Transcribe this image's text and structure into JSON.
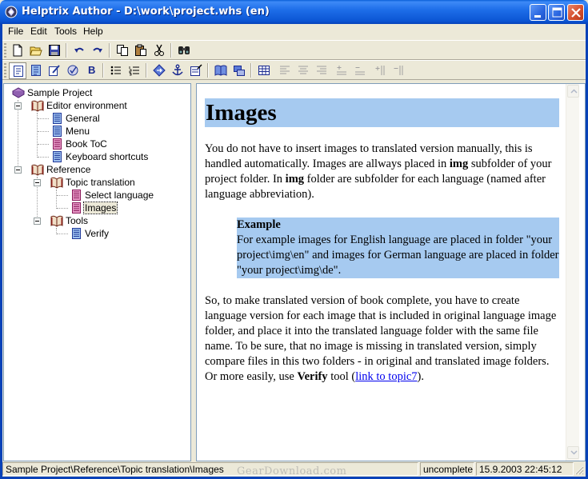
{
  "window": {
    "title": "Helptrix Author - D:\\work\\project.whs (en)",
    "app_icon": "helptrix-app-icon",
    "buttons": [
      "minimize-icon",
      "maximize-icon",
      "close-icon"
    ]
  },
  "menu": {
    "items": [
      "File",
      "Edit",
      "Tools",
      "Help"
    ]
  },
  "toolbar1": {
    "buttons": [
      "new-icon",
      "open-icon",
      "save-icon",
      "undo-icon",
      "redo-icon",
      "copy-icon",
      "paste-icon",
      "cut-icon",
      "find-icon"
    ]
  },
  "toolbar2": {
    "buttons": [
      "topic-view-icon",
      "source-view-icon",
      "edit-icon",
      "spellcheck-icon",
      "bold-icon",
      "bullet-list-icon",
      "numbered-list-icon",
      "link-icon",
      "anchor-icon",
      "properties-icon",
      "book-icon",
      "publish-icon",
      "table-icon",
      "align-left-icon",
      "align-center-icon",
      "align-right-icon",
      "insert-row-icon",
      "delete-row-icon",
      "insert-column-icon",
      "delete-column-icon"
    ],
    "bold_label": "B"
  },
  "tree": {
    "root": "Sample Project",
    "items": [
      {
        "label": "Editor environment",
        "type": "book"
      },
      {
        "label": "General",
        "type": "page"
      },
      {
        "label": "Menu",
        "type": "page"
      },
      {
        "label": "Book ToC",
        "type": "page-pink"
      },
      {
        "label": "Keyboard shortcuts",
        "type": "page"
      },
      {
        "label": "Reference",
        "type": "book"
      },
      {
        "label": "Topic translation",
        "type": "book"
      },
      {
        "label": "Select language",
        "type": "page-pink"
      },
      {
        "label": "Images",
        "type": "page-pink"
      },
      {
        "label": "Tools",
        "type": "book"
      },
      {
        "label": "Verify",
        "type": "page"
      }
    ],
    "selected": "Images"
  },
  "document": {
    "title": "Images",
    "p1_a": "You do not have to insert images to translated version manually, this is handled automatically. Images are allways placed in ",
    "p1_b": "img",
    "p1_c": " subfolder of your project folder. In ",
    "p1_d": "img",
    "p1_e": " folder are subfolder for each language (named after language abbreviation).",
    "example_title": "Example",
    "example_text": "For example images for English language are placed in folder \"your project\\img\\en\" and images for German language are placed in folder \"your project\\img\\de\".",
    "p2_a": "So, to make translated version of book complete, you have to create language version for each image that is included in original language image folder, and place it into the translated language folder with the same file name. To be sure, that no image is missing in translated version, simply compare files in this two folders - in original and translated image folders. Or more easily, use ",
    "p2_b": "Verify",
    "p2_c": " tool (",
    "p2_link": "link to topic7",
    "p2_d": ")."
  },
  "status": {
    "path": "Sample Project\\Reference\\Topic translation\\Images",
    "state": "uncomplete",
    "datetime": "15.9.2003 22:45:12"
  },
  "watermark": "GearDownload.com",
  "colors": {
    "highlight": "#a6caf0",
    "titlebar": "#0b55d3",
    "face": "#ece9d8"
  }
}
